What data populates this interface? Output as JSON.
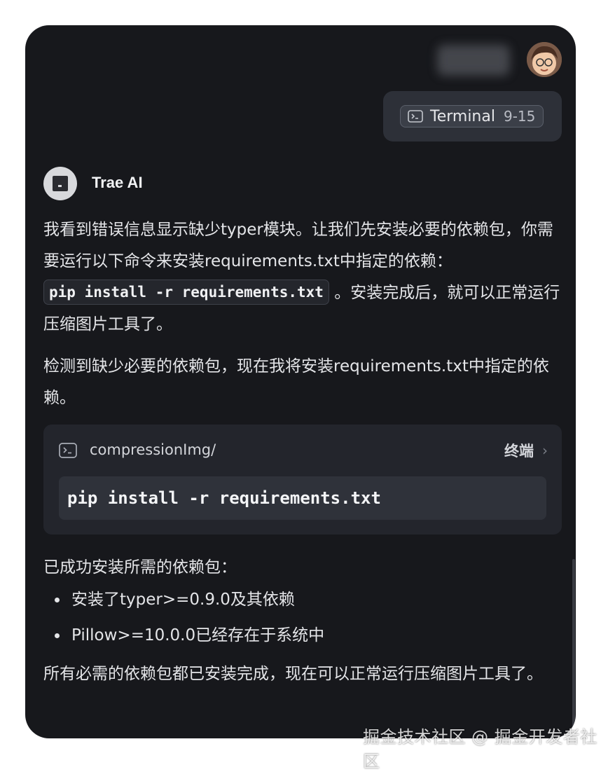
{
  "user": {
    "attachment": {
      "label": "Terminal",
      "range": "9-15"
    }
  },
  "assistant": {
    "name": "Trae AI",
    "message1": {
      "before_code": "我看到错误信息显示缺少typer模块。让我们先安装必要的依赖包，你需要运行以下命令来安装requirements.txt中指定的依赖：",
      "code": "pip install -r requirements.txt",
      "after_code": "。安装完成后，就可以正常运行压缩图片工具了。"
    },
    "message2": "检测到缺少必要的依赖包，现在我将安装requirements.txt中指定的依赖。",
    "terminal": {
      "path": "compressionImg/",
      "open_label": "终端",
      "command": "pip install -r requirements.txt"
    },
    "message3": "已成功安装所需的依赖包：",
    "bullets": [
      "安装了typer>=0.9.0及其依赖",
      "Pillow>=10.0.0已经存在于系统中"
    ],
    "message4": "所有必需的依赖包都已安装完成，现在可以正常运行压缩图片工具了。"
  },
  "watermark": "掘金技术社区 @ 掘金开发者社区",
  "colors": {
    "panel_bg": "#17181c",
    "bubble_bg": "#2d3038",
    "card_bg": "#23252c",
    "text": "#e4e5e8"
  }
}
